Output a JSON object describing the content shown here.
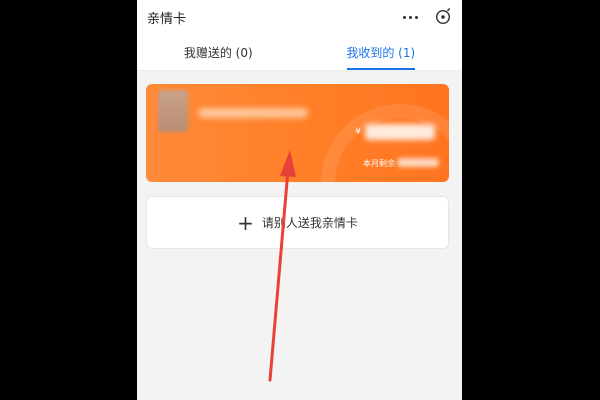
{
  "header": {
    "title": "亲情卡",
    "more_icon": "more-horizontal-icon",
    "close_icon": "circle-close-icon"
  },
  "tabs": [
    {
      "label": "我赠送的 (0)",
      "active": false
    },
    {
      "label": "我收到的 (1)",
      "active": true
    }
  ],
  "card": {
    "currency": "¥",
    "remaining_label": "本月剩余",
    "color": "#ff7f27"
  },
  "add_card": {
    "label": "请别人送我亲情卡",
    "icon": "plus-icon"
  },
  "colors": {
    "accent": "#1a74e8",
    "arrow": "#e8413a"
  }
}
